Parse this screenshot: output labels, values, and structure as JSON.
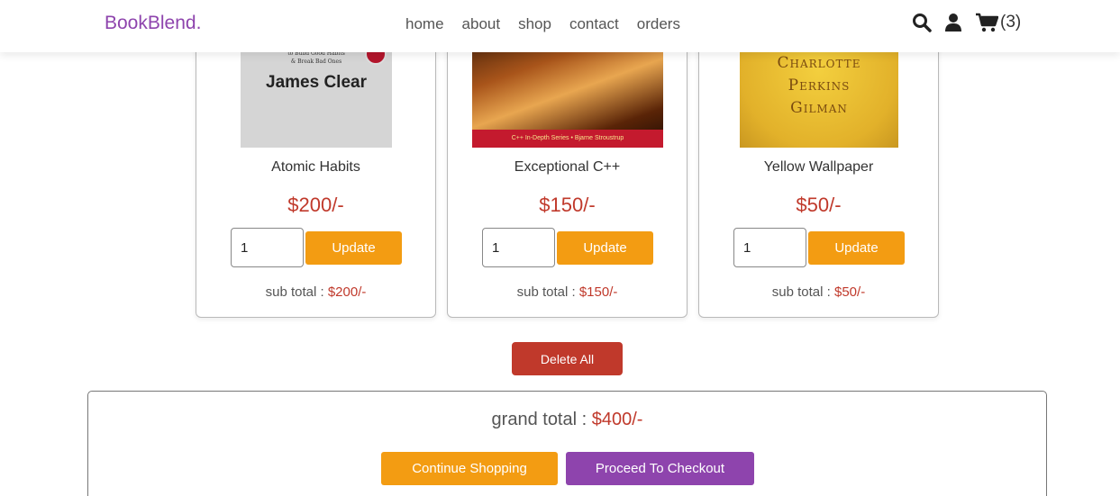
{
  "header": {
    "logo": "BookBlend.",
    "nav": [
      "home",
      "about",
      "shop",
      "contact",
      "orders"
    ],
    "cart_count": "(3)",
    "icons": [
      "search-icon",
      "user-icon",
      "cart-icon"
    ]
  },
  "colors": {
    "brand": "#8e44ad",
    "accent": "#f39c12",
    "price": "#c0392b",
    "danger": "#c0392b"
  },
  "products": [
    {
      "title": "Atomic Habits",
      "price": "$200/-",
      "qty": "1",
      "update_label": "Update",
      "subtotal_label": "sub total : ",
      "subtotal": "$200/-",
      "cover": {
        "tagline": "An Easy & Proven Way\nto Build Good Habits\n& Break Bad Ones",
        "author": "James Clear"
      }
    },
    {
      "title": "Exceptional C++",
      "price": "$150/-",
      "qty": "1",
      "update_label": "Update",
      "subtotal_label": "sub total : ",
      "subtotal": "$150/-",
      "cover": {
        "band": "C++ In-Depth Series • Bjarne Stroustrup"
      }
    },
    {
      "title": "Yellow Wallpaper",
      "price": "$50/-",
      "qty": "1",
      "update_label": "Update",
      "subtotal_label": "sub total : ",
      "subtotal": "$50/-",
      "cover": {
        "author": "Charlotte Perkins Gilman"
      }
    }
  ],
  "delete_all_label": "Delete All",
  "summary": {
    "grand_label": "grand total : ",
    "grand_total": "$400/-",
    "continue_label": "Continue Shopping",
    "checkout_label": "Proceed To Checkout"
  }
}
